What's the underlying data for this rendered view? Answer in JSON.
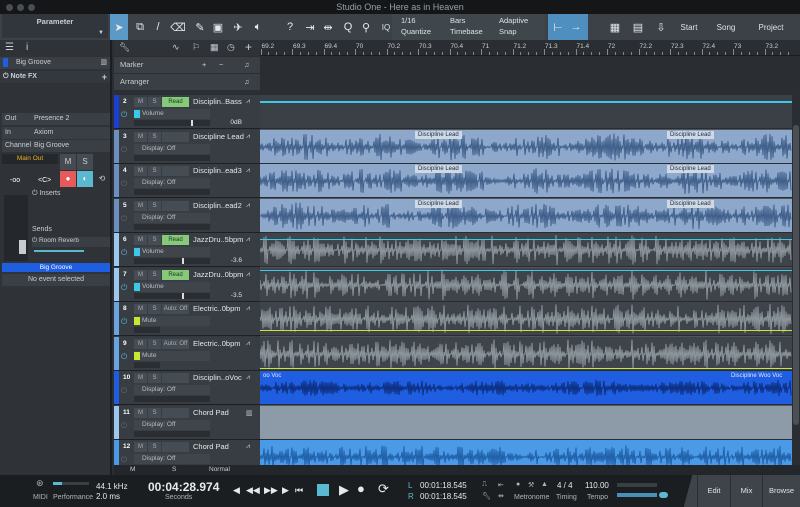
{
  "window": {
    "title": "Studio One - Here as in Heaven"
  },
  "toolbar": {
    "parameter_label": "Parameter",
    "quantize_value": "1/16",
    "quantize_label": "Quantize",
    "timebase_value": "Bars",
    "timebase_label": "Timebase",
    "snap_value": "Adaptive",
    "snap_label": "Snap",
    "iq_label": "IQ",
    "start_label": "Start",
    "song_label": "Song",
    "project_label": "Project"
  },
  "ruler": {
    "labels": [
      "69.2",
      "69.3",
      "69.4",
      "70",
      "70.2",
      "70.3",
      "70.4",
      "71",
      "71.2",
      "71.3",
      "71.4",
      "72",
      "72.2",
      "72.3",
      "72.4",
      "73",
      "73.2"
    ]
  },
  "global_tracks": {
    "marker": "Marker",
    "arranger": "Arranger"
  },
  "inspector": {
    "track_name": "Big Groove",
    "note_fx": "Note FX",
    "out_label": "Out",
    "out_value": "Presence 2",
    "in_label": "In",
    "in_value": "Axiom",
    "channel_label": "Channel",
    "channel_value": "Big Groove",
    "main_out": "Main Out",
    "m": "M",
    "s": "S",
    "volume": "-oo",
    "pan": "<C>",
    "inserts": "Inserts",
    "sends": "Sends",
    "send_name": "Room Reverb",
    "channel_name": "Big Groove",
    "no_event": "No event selected"
  },
  "tracks": [
    {
      "num": "2",
      "name": "Disciplin..Bass",
      "auto": "Read",
      "param": "Volume",
      "value": "0dB",
      "color": "#1a3fd6",
      "swatch": "#3cc8e8"
    },
    {
      "num": "3",
      "name": "Discipline Lead",
      "auto": "",
      "param": "Display: Off",
      "value": "",
      "color": "#6d8fc0"
    },
    {
      "num": "4",
      "name": "Disciplin..ead3",
      "auto": "",
      "param": "Display: Off",
      "value": "",
      "color": "#6d8fc0"
    },
    {
      "num": "5",
      "name": "Disciplin..ead2",
      "auto": "",
      "param": "Display: Off",
      "value": "",
      "color": "#6d8fc0"
    },
    {
      "num": "6",
      "name": "JazzDru..5bpm",
      "auto": "Read",
      "param": "Volume",
      "value": "-3.6",
      "color": "#9cc8ef",
      "swatch": "#3cc8e8"
    },
    {
      "num": "7",
      "name": "JazzDru..0bpm",
      "auto": "Read",
      "param": "Volume",
      "value": "-3.5",
      "color": "#9cc8ef",
      "swatch": "#3cc8e8"
    },
    {
      "num": "8",
      "name": "Electric..0bpm",
      "auto": "Auto: Off",
      "param": "Mute",
      "value": "",
      "color": "#6aa3e0",
      "swatch": "#c8e632"
    },
    {
      "num": "9",
      "name": "Electric..0bpm",
      "auto": "Auto: Off",
      "param": "Mute",
      "value": "",
      "color": "#6aa3e0",
      "swatch": "#c8e632"
    },
    {
      "num": "10",
      "name": "Disciplin..oVoc",
      "auto": "",
      "param": "Display: Off",
      "value": "",
      "color": "#1f5ee0"
    },
    {
      "num": "11",
      "name": "Chord Pad",
      "auto": "",
      "param": "Display: Off",
      "value": "",
      "color": "#9cc8ef"
    },
    {
      "num": "12",
      "name": "Chord Pad",
      "auto": "",
      "param": "Display: Off",
      "value": "",
      "color": "#4a9ae8"
    }
  ],
  "track_buttons": {
    "m": "M",
    "s": "S"
  },
  "clips": {
    "lead": "Discipline Lead",
    "voc_left": "oo Voc",
    "voc_right": "Discipline Woo Voc"
  },
  "tracklist_footer": {
    "m": "M",
    "s": "S",
    "mode": "Normal"
  },
  "transport": {
    "midi": "MIDI",
    "performance": "Performance",
    "sample_rate": "44.1 kHz",
    "latency": "2.0 ms",
    "time": "00:04:28.974",
    "time_format": "Seconds",
    "loop_l": "00:01:18.545",
    "loop_r": "00:01:18.545",
    "l": "L",
    "r": "R",
    "metronome": "Metronome",
    "timing_value": "4 / 4",
    "timing": "Timing",
    "tempo_value": "110.00",
    "tempo": "Tempo"
  },
  "views": {
    "edit": "Edit",
    "mix": "Mix",
    "browse": "Browse"
  }
}
